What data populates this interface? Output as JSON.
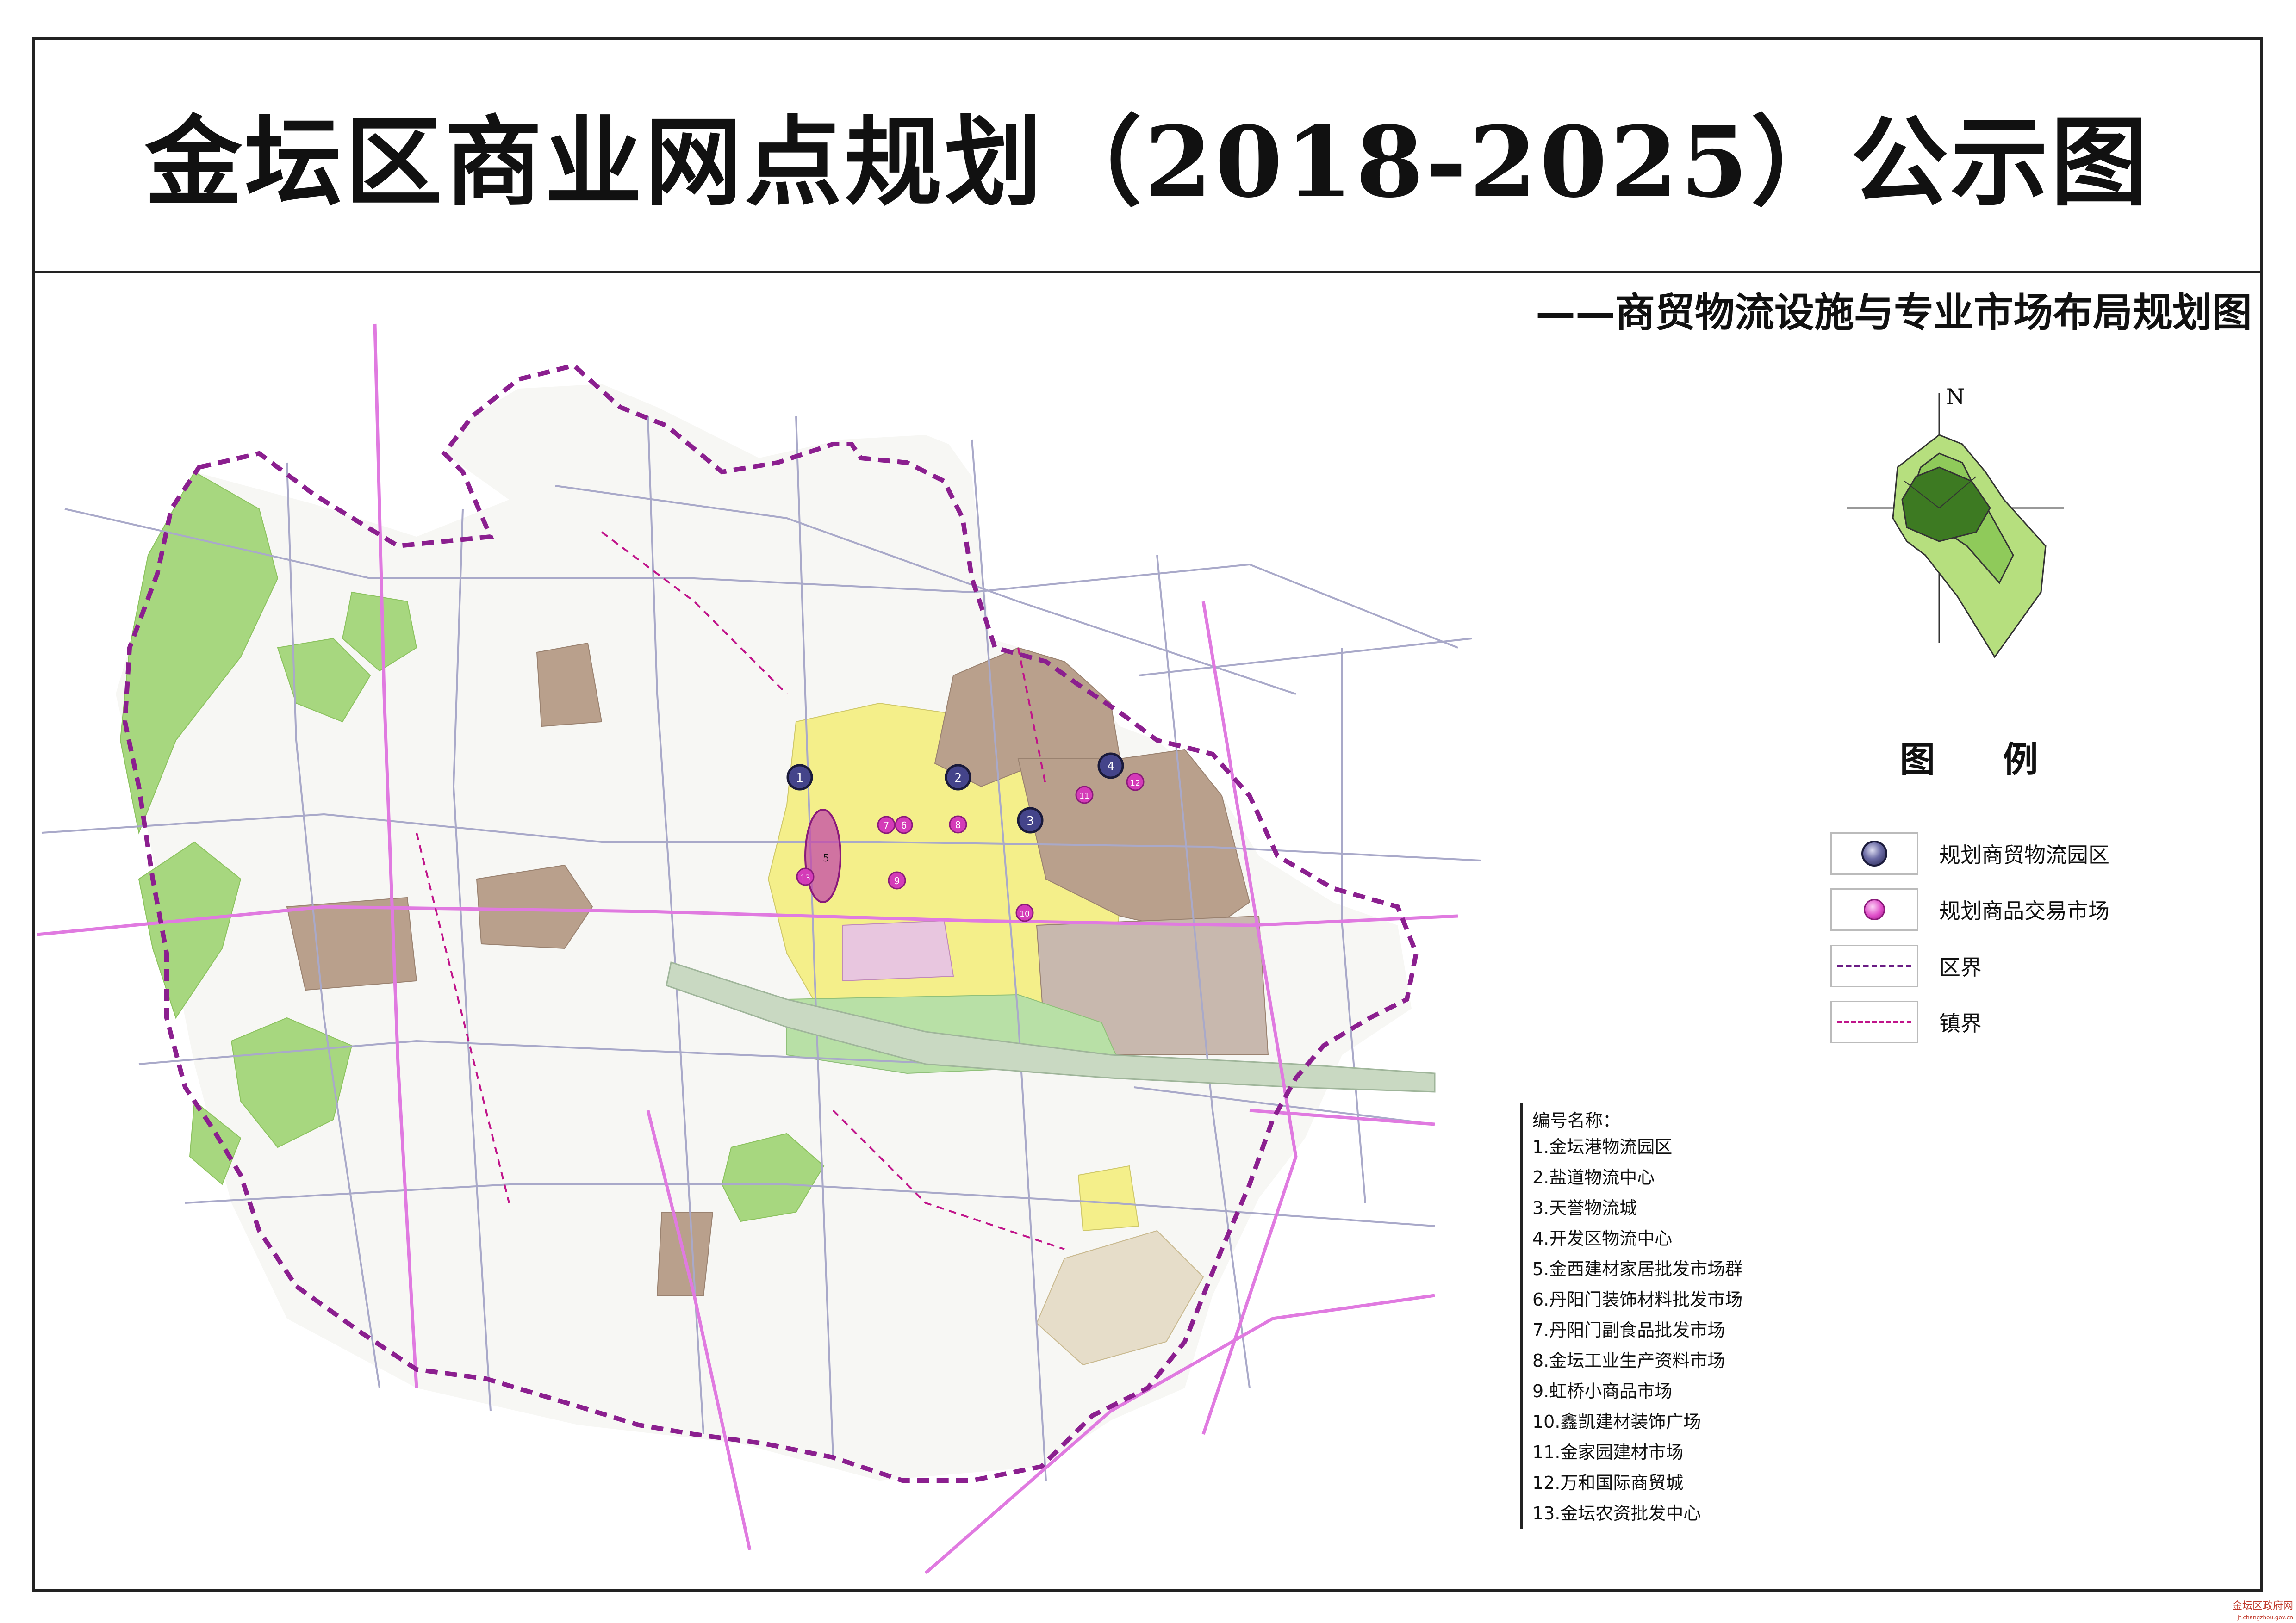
{
  "title": "金坛区商业网点规划（2018-2025）公示图",
  "subtitle": "——商贸物流设施与专业市场布局规划图",
  "compass": {
    "north_label": "N"
  },
  "legend": {
    "title": "图 例",
    "items": [
      {
        "label": "规划商贸物流园区",
        "symbol": "logistics-park-icon"
      },
      {
        "label": "规划商品交易市场",
        "symbol": "market-icon"
      },
      {
        "label": "区界",
        "symbol": "district-boundary-line"
      },
      {
        "label": "镇界",
        "symbol": "town-boundary-line"
      }
    ]
  },
  "names_list": {
    "header": "编号名称：",
    "items": [
      "1.金坛港物流园区",
      "2.盐道物流中心",
      "3.天誉物流城",
      "4.开发区物流中心",
      "5.金西建材家居批发市场群",
      "6.丹阳门装饰材料批发市场",
      "7.丹阳门副食品批发市场",
      "8.金坛工业生产资料市场",
      "9.虹桥小商品市场",
      "10.鑫凯建材装饰广场",
      "11.金家园建材市场",
      "12.万和国际商贸城",
      "13.金坛农资批发中心"
    ]
  },
  "map_markers": {
    "parks": [
      "1",
      "2",
      "3",
      "4"
    ],
    "markets": [
      "5",
      "6",
      "7",
      "8",
      "9",
      "10",
      "11",
      "12",
      "13"
    ]
  },
  "watermark": {
    "line1": "金坛区政府网",
    "line2": "jt.changzhou.gov.cn"
  },
  "colors": {
    "district_boundary": "#8b1f8f",
    "town_boundary": "#c0148a",
    "forest_green": "#9fd37a",
    "built_brown": "#b9a08c",
    "built_yellow": "#f4ef8a",
    "road_gray": "#a9a9c9",
    "highway_pink": "#e07ae0",
    "park_marker": "#3a3a7a",
    "market_marker": "#d43bb8"
  }
}
